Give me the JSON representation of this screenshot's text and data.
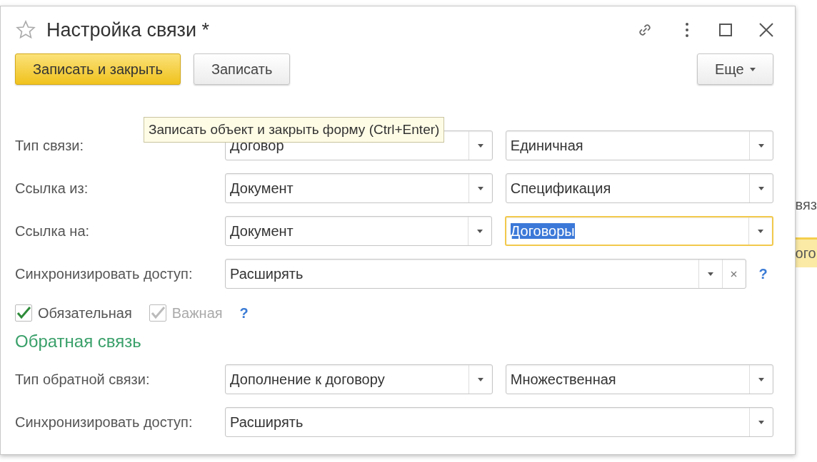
{
  "window": {
    "title": "Настройка связи *"
  },
  "toolbar": {
    "buttons": [
      {
        "label": "Записать и закрыть",
        "kind": "primary"
      },
      {
        "label": "Записать",
        "kind": "default"
      }
    ],
    "more": "Еще"
  },
  "tooltip": "Записать объект и закрыть форму (Ctrl+Enter)",
  "rows": [
    {
      "label": "Тип связи:",
      "fields": [
        {
          "value": "Договор",
          "focused": false
        },
        {
          "value": "Единичная",
          "focused": false
        }
      ]
    },
    {
      "label": "Ссылка из:",
      "fields": [
        {
          "value": "Документ",
          "focused": false
        },
        {
          "value": "Спецификация",
          "focused": false
        }
      ]
    },
    {
      "label": "Ссылка на:",
      "fields": [
        {
          "value": "Документ",
          "focused": false
        },
        {
          "value": "Договоры",
          "focused": true
        }
      ]
    },
    {
      "label": "Синхронизировать доступ:",
      "fields": [
        {
          "value": "Расширять",
          "focused": false,
          "clear": true
        }
      ],
      "help": "?"
    }
  ],
  "checkboxes": [
    {
      "label": "Обязательная",
      "checked": true,
      "disabled": false
    },
    {
      "label": "Важная",
      "checked": true,
      "disabled": true
    }
  ],
  "checkboxes_help": "?",
  "section_title": "Обратная связь",
  "back_rows": [
    {
      "label": "Тип обратной связи:",
      "fields": [
        {
          "value": "Дополнение к договору",
          "focused": false
        },
        {
          "value": "Множественная",
          "focused": false
        }
      ]
    },
    {
      "label": "Синхронизировать доступ:",
      "fields": [
        {
          "value": "Расширять",
          "focused": false
        }
      ]
    }
  ],
  "background_fragments": [
    {
      "text": "вяз",
      "highlighted": false
    },
    {
      "text": "ого",
      "highlighted": true
    }
  ]
}
